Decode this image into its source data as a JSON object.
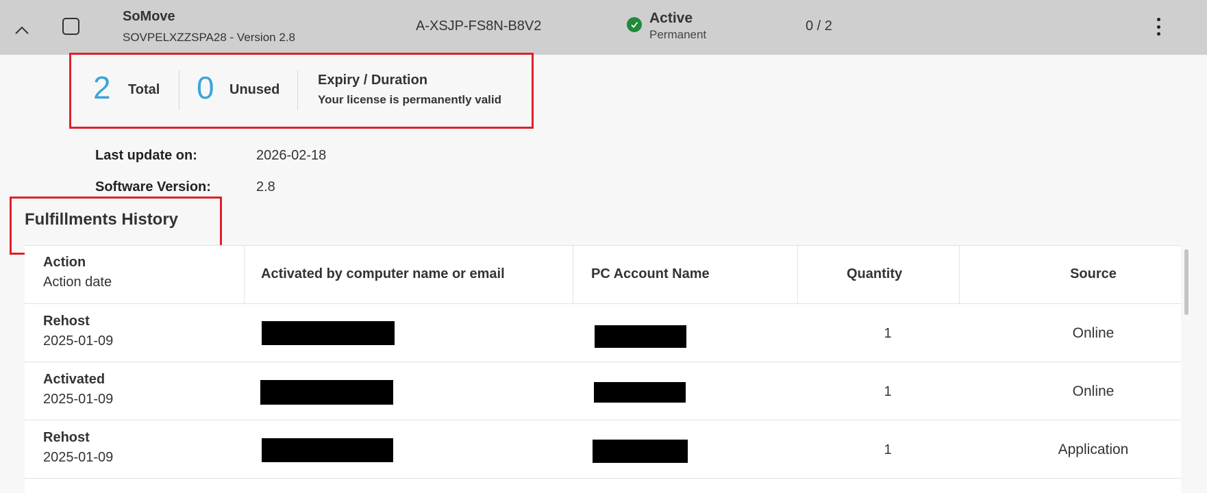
{
  "header": {
    "product_name": "SoMove",
    "product_sub": "SOVPELXZZSPA28 - Version 2.8",
    "license_key": "A-XSJP-FS8N-B8V2",
    "status": "Active",
    "status_sub": "Permanent",
    "usage": "0 / 2",
    "status_color": "#1f8a3a"
  },
  "summary": {
    "total_value": "2",
    "total_label": "Total",
    "unused_value": "0",
    "unused_label": "Unused",
    "expiry_title": "Expiry / Duration",
    "expiry_desc": "Your license is permanently valid",
    "accent_color": "#3aa6d8"
  },
  "meta": {
    "last_update_label": "Last update on:",
    "last_update_value": "2026-02-18",
    "software_version_label": "Software Version:",
    "software_version_value": "2.8"
  },
  "history": {
    "title": "Fulfillments History",
    "columns": {
      "action": "Action",
      "action_date": "Action date",
      "activated_by": "Activated by computer name or email",
      "pc_account": "PC Account Name",
      "quantity": "Quantity",
      "source": "Source"
    },
    "rows": [
      {
        "action": "Rehost",
        "date": "2025-01-09",
        "quantity": "1",
        "source": "Online"
      },
      {
        "action": "Activated",
        "date": "2025-01-09",
        "quantity": "1",
        "source": "Online"
      },
      {
        "action": "Rehost",
        "date": "2025-01-09",
        "quantity": "1",
        "source": "Application"
      }
    ]
  },
  "highlight_color": "#e0202a"
}
